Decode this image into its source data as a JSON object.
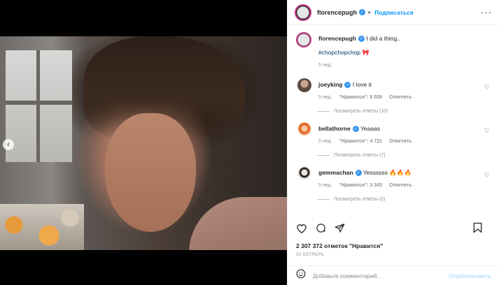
{
  "post": {
    "author": "florencepugh",
    "follow_label": "Подписаться",
    "caption": "I did a thing..",
    "hashtag": "#chopchopchop",
    "caption_emoji": "🎀",
    "caption_age": "5 нед.",
    "media_dots": 2,
    "active_dot": 2
  },
  "comments": [
    {
      "user": "joeyking",
      "text": "I love it",
      "age": "5 нед.",
      "likes": "\"Нравится\": 8 026",
      "reply": "Ответить",
      "view_replies": "Посмотреть ответы (10)"
    },
    {
      "user": "bellathorne",
      "text": "Yeaaas",
      "age": "5 нед.",
      "likes": "\"Нравится\": 4 721",
      "reply": "Ответить",
      "view_replies": "Посмотреть ответы (7)"
    },
    {
      "user": "gemmachan",
      "text": "Yessssss 🔥🔥🔥",
      "age": "5 нед.",
      "likes": "\"Нравится\": 3 343",
      "reply": "Ответить",
      "view_replies": "Посмотреть ответы (2)"
    }
  ],
  "footer": {
    "likes": "2 307 372 отметок \"Нравится\"",
    "date": "30 ОКТЯБРЬ",
    "comment_placeholder": "Добавьте комментарий...",
    "publish_label": "Опубликовать"
  },
  "icons": {
    "prev": "chevron-left-icon",
    "verified": "verified-badge-icon",
    "more": "more-icon",
    "heart": "heart-icon",
    "comment": "comment-icon",
    "share": "share-icon",
    "save": "bookmark-icon",
    "emoji": "emoji-icon"
  }
}
